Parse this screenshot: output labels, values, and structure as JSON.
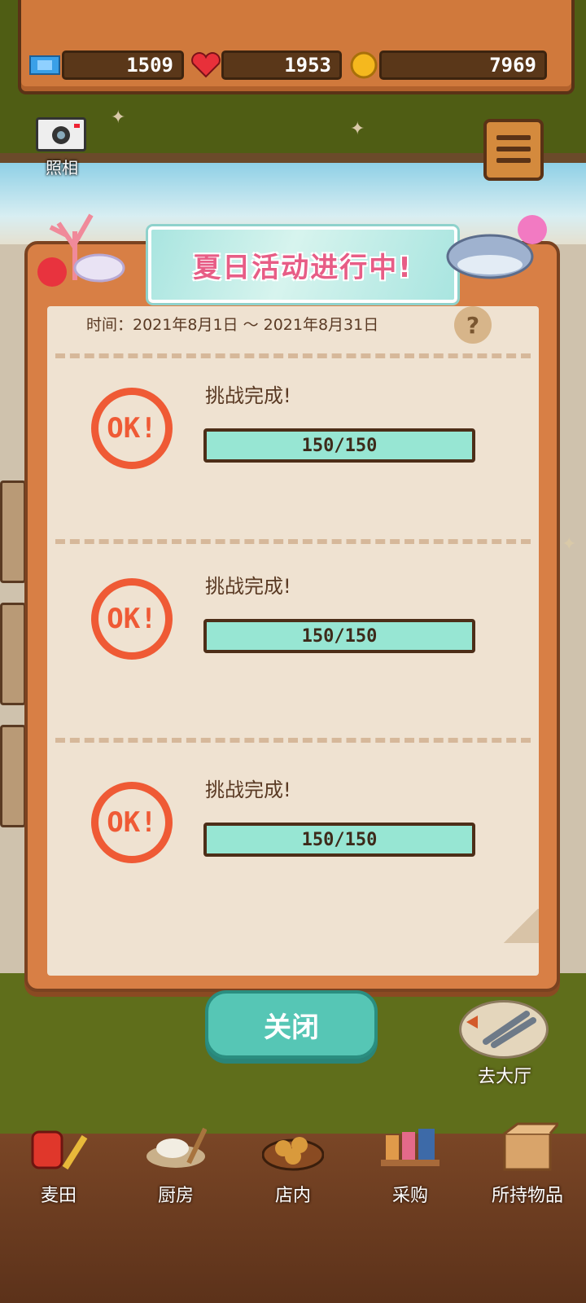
{
  "resources": {
    "tickets": "1509",
    "hearts": "1953",
    "coins": "7969",
    "ticket_icon": "ticket-icon",
    "heart_icon": "heart-icon",
    "coin_icon": "coin-icon"
  },
  "camera": {
    "label": "照相",
    "icon": "camera-icon"
  },
  "menu": {
    "icon": "menu-icon"
  },
  "event": {
    "title": "夏日活动进行中!",
    "date": "时间：2021年8月1日 ～ 2021年8月31日",
    "help_label": "?",
    "ok_stamp_text": "OK!",
    "challenges": [
      {
        "label": "挑战完成!",
        "progress": "150/150",
        "current": 150,
        "total": 150
      },
      {
        "label": "挑战完成!",
        "progress": "150/150",
        "current": 150,
        "total": 150
      },
      {
        "label": "挑战完成!",
        "progress": "150/150",
        "current": 150,
        "total": 150
      }
    ]
  },
  "close_button": "关闭",
  "hall": {
    "label": "去大厅",
    "icon": "tongs-icon"
  },
  "nav": [
    {
      "label": "麦田",
      "icon": "wheat-sack-icon"
    },
    {
      "label": "厨房",
      "icon": "dough-icon"
    },
    {
      "label": "店内",
      "icon": "bread-tray-icon"
    },
    {
      "label": "采购",
      "icon": "shop-shelf-icon"
    },
    {
      "label": "所持物品",
      "icon": "box-icon"
    }
  ],
  "colors": {
    "accent_teal": "#56c6b5",
    "progress_fill": "#97e6d3",
    "ok_red": "#ef5a35",
    "title_pink": "#e75d86",
    "panel_orange": "#d87f45"
  }
}
